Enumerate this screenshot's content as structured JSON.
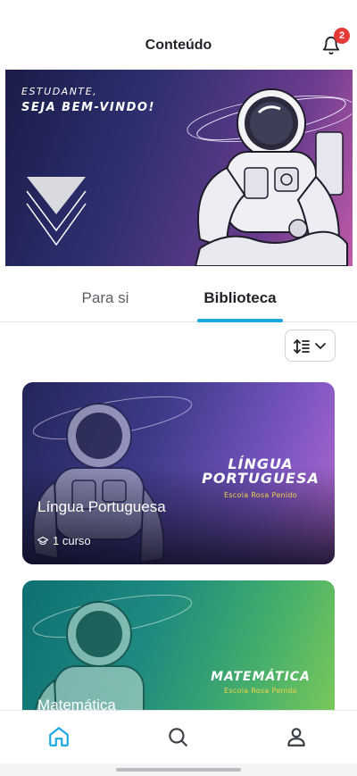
{
  "header": {
    "title": "Conteúdo",
    "notification_count": "2"
  },
  "hero": {
    "greeting_line1": "ESTUDANTE,",
    "greeting_line2": "SEJA BEM-VINDO!"
  },
  "tabs": [
    {
      "label": "Para si",
      "active": false
    },
    {
      "label": "Biblioteca",
      "active": true
    }
  ],
  "colors": {
    "accent": "#1ba8e0",
    "badge": "#e53935",
    "school_text": "#f2d24a"
  },
  "courses": [
    {
      "title": "Língua Portuguesa",
      "brand_title": "LÍNGUA PORTUGUESA",
      "brand_school": "Escola Rosa Penido",
      "meta": "1 curso",
      "meta_icon": "graduation-cap-icon"
    },
    {
      "title": "Matemática",
      "brand_title": "MATEMÁTICA",
      "brand_school": "Escola Rosa Penido"
    }
  ],
  "bottom_nav": [
    {
      "name": "home",
      "icon": "home-icon",
      "active": true
    },
    {
      "name": "search",
      "icon": "search-icon",
      "active": false
    },
    {
      "name": "profile",
      "icon": "user-icon",
      "active": false
    }
  ]
}
